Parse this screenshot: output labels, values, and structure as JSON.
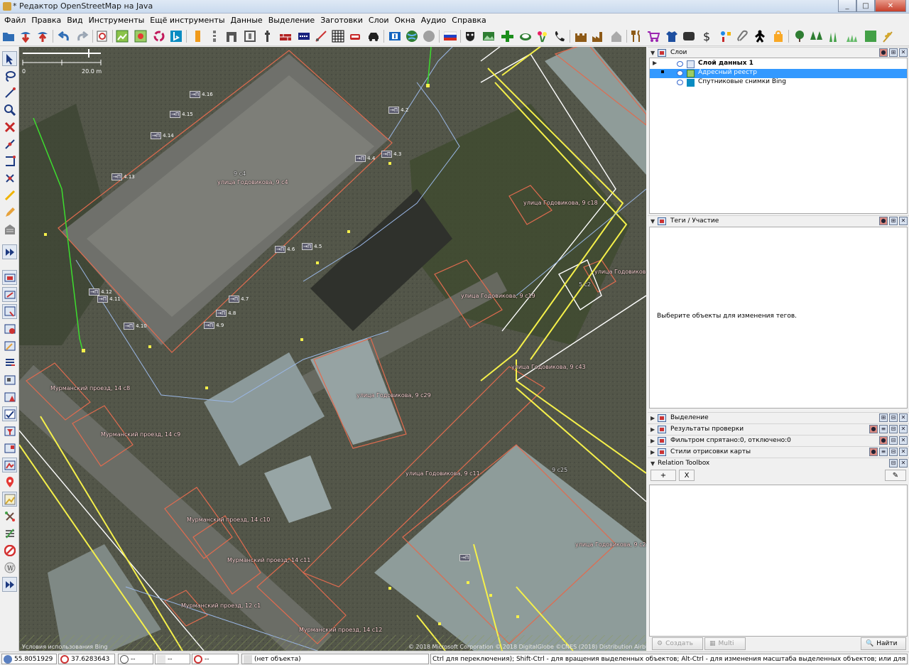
{
  "window": {
    "title": "* Редактор OpenStreetMap на Java",
    "buttons": [
      "_",
      "□",
      "✕"
    ]
  },
  "menu": [
    "Файл",
    "Правка",
    "Вид",
    "Инструменты",
    "Ещё инструменты",
    "Данные",
    "Выделение",
    "Заготовки",
    "Слои",
    "Окна",
    "Аудио",
    "Справка"
  ],
  "toolbar_icons": [
    "open-icon",
    "download-icon",
    "upload-icon",
    "undo-icon",
    "redo-icon",
    "preferences-icon",
    "imagery-icon",
    "offset-icon",
    "recycle-icon",
    "bing-icon",
    "traffic-light-icon",
    "bollard-icon",
    "gate-icon",
    "barrier-icon",
    "fence-icon",
    "wall-icon",
    "barrier-line-icon",
    "hatched-area-icon",
    "car-icon",
    "steering-icon",
    "info-sign-icon",
    "globe-icon",
    "circle-icon",
    "russia-flag-icon",
    "theatre-icon",
    "picture-icon",
    "pharmacy-icon",
    "bank-icon",
    "flowers-icon",
    "phone-icon",
    "castle-icon",
    "factory-icon",
    "home-icon",
    "restaurant-icon",
    "shop-cart-icon",
    "clothes-icon",
    "tv-icon",
    "dollar-icon",
    "services-icon",
    "clip-icon",
    "person-icon",
    "bag-icon",
    "tree-icon",
    "forest-icon",
    "grass-icon",
    "grass2-icon",
    "landuse-icon",
    "wheat-icon"
  ],
  "sidebar_icons": [
    "select-tool-icon",
    "lasso-tool-icon",
    "draw-tool-icon",
    "zoom-tool-icon",
    "delete-tool-icon",
    "split-way-icon",
    "combine-way-icon",
    "join-nodes-icon",
    "draw-line-icon",
    "pencil-icon",
    "building-tool-icon",
    "more-tools-icon",
    "layers-toggle-icon",
    "layer-tool-icon",
    "selection-list-icon",
    "warning-icon",
    "edit-icon",
    "command-icon",
    "map-icon",
    "alert-icon",
    "validation-icon",
    "filter-icon",
    "layer-list-icon",
    "map-style-icon",
    "marker-icon",
    "map-paint-icon",
    "relation-icon",
    "connections-icon",
    "no-entry-icon",
    "wikipedia-icon",
    "more-panels-icon"
  ],
  "map": {
    "scale_start": "0",
    "scale_end": "20.0 m",
    "copyright": "© 2018 Microsoft Corporation © 2018 DigitalGlobe ©CNES (2018) Distribution Airbus DS",
    "bing_terms": "Условия использования Bing",
    "building_labels": [
      "улица Годовикова, 9 с4",
      "улица Годовикова, 9 с18",
      "улица Годовикова, 9 с19",
      "улица Годовикова",
      "улица Годовикова, 9 с43",
      "улица Годовикова, 9 с29",
      "Мурманский проезд, 14 с8",
      "Мурманский проезд, 14 с9",
      "улица Годовикова, 9 с11",
      "Мурманский проезд, 14 с10",
      "Мурманский проезд, 14 с11",
      "улица Годовикова, 9 с25",
      "Мурманский проезд, 12 с1",
      "Мурманский проезд, 14 с12"
    ],
    "small_labels": [
      "9 с4",
      "5 с2",
      "9 с25"
    ],
    "entrances": [
      "4.16",
      "4.15",
      "4.14",
      "4.13",
      "4.2",
      "4.3",
      "4.4",
      "4.5",
      "4.6",
      "4.7",
      "4.8",
      "4.9",
      "4.10",
      "4.11",
      "4.12"
    ],
    "entrance_mark": "→П"
  },
  "panels": {
    "layers": {
      "title": "Слои",
      "items": [
        {
          "name": "Слой данных 1",
          "bold": true
        },
        {
          "name": "Адресный реестр",
          "selected": true
        },
        {
          "name": "Спутниковые снимки Bing"
        }
      ]
    },
    "tags": {
      "title": "Теги / Участие",
      "hint": "Выберите объекты для изменения тегов."
    },
    "collapsed": [
      "Выделение",
      "Результаты проверки",
      "Фильтром спрятано:0, отключено:0",
      "Стили отрисовки карты"
    ],
    "relation_toolbox": {
      "title": "Relation Toolbox",
      "buttons": [
        "+",
        "X",
        "✎"
      ]
    },
    "bottom_buttons": {
      "create": "Создать",
      "multi": "Multi",
      "find": "Найти"
    }
  },
  "status": {
    "lat": "55.8051929",
    "lon": "37.6283643",
    "heading": "--",
    "angle": "--",
    "distance": "--",
    "object": "(нет объекта)",
    "help": "Ctrl для переключения); Shift-Ctrl - для вращения выделенных объектов; Alt-Ctrl - для изменения масштаба выделенных объектов; или для изменения выделения"
  },
  "colors": {
    "selected_row": "#3399ff",
    "building_outline": "#e06b4f",
    "road_yellow": "#f5f04a",
    "road_white": "#ffffff",
    "path_green": "#3ddc2e"
  }
}
